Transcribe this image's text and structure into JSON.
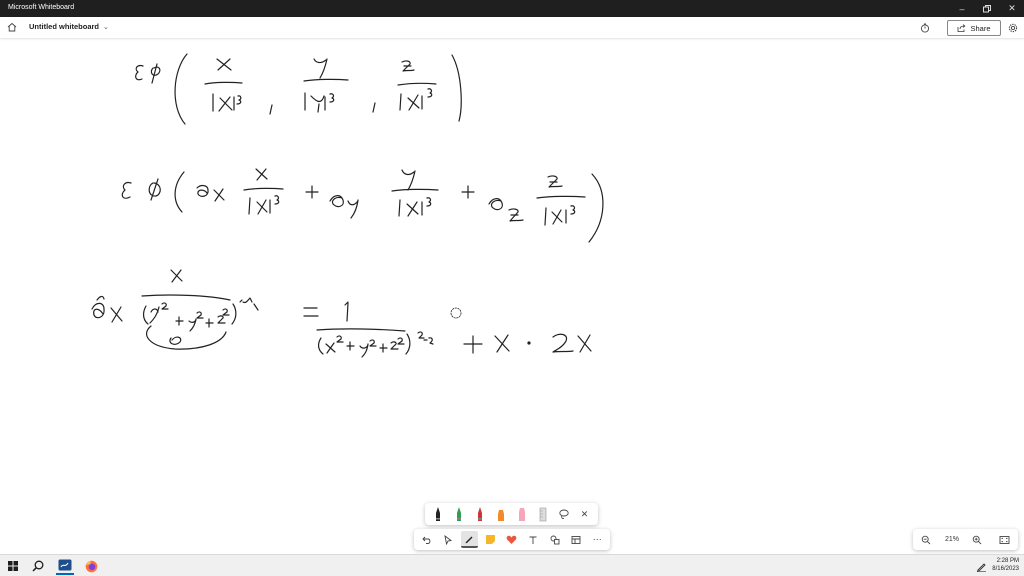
{
  "window": {
    "title": "Microsoft Whiteboard"
  },
  "toolbar": {
    "board_name": "Untitled whiteboard",
    "share_label": "Share"
  },
  "zoom": {
    "level": "21%"
  },
  "taskbar": {
    "time": "2:28 PM",
    "date": "8/16/2023"
  },
  "pens": [
    {
      "name": "black-pen",
      "color": "#222222"
    },
    {
      "name": "green-pen",
      "color": "#2e9e4f"
    },
    {
      "name": "red-pen",
      "color": "#d13438"
    },
    {
      "name": "orange-highlighter",
      "color": "#f28c28"
    },
    {
      "name": "pink-highlighter",
      "color": "#f4a7b9"
    },
    {
      "name": "ruler",
      "color": "#bbbbbb"
    }
  ],
  "colors": {
    "titlebar": "#1f1f1f",
    "accent": "#f7941d"
  }
}
